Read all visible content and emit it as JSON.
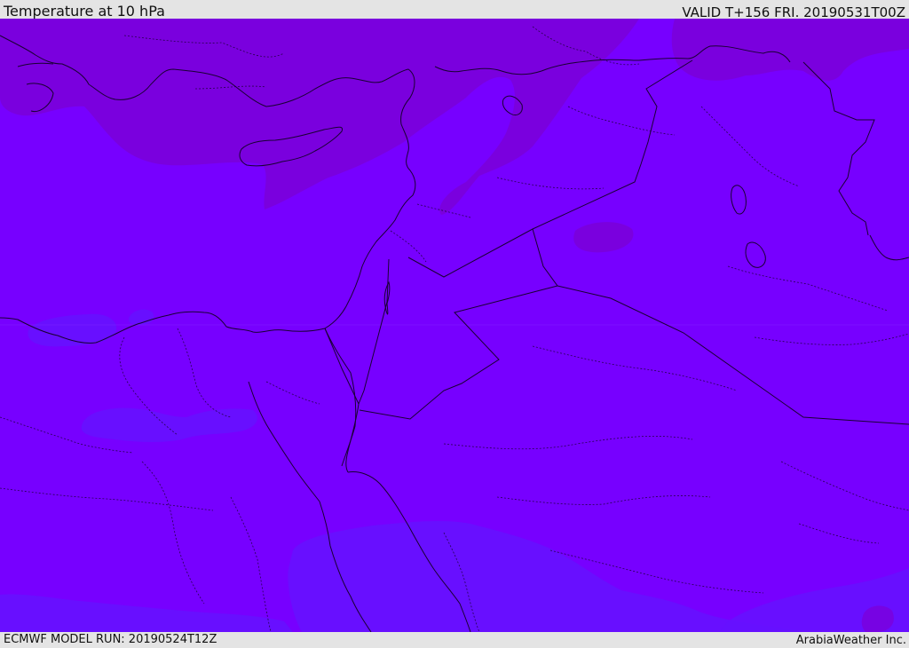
{
  "header": {
    "title": "Temperature at 10 hPa",
    "valid": "VALID T+156 FRI. 20190531T00Z"
  },
  "footer": {
    "model_run": "ECMWF MODEL RUN: 20190524T12Z",
    "credit": "ArabiaWeather Inc."
  },
  "map": {
    "parameter": "temperature",
    "level": "10 hPa",
    "colors": {
      "base_fill": "#7700ff",
      "warm_fill": "#7a00dc",
      "cool_fill": "#6611ff",
      "coastline": "#1a0033",
      "border": "#1a0033"
    }
  }
}
